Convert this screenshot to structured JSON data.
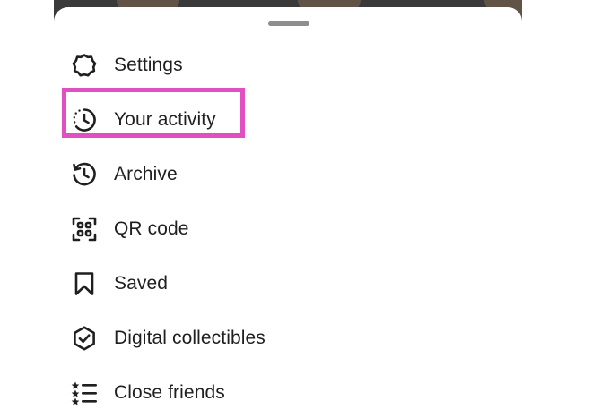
{
  "menu": {
    "items": [
      {
        "id": "settings",
        "label": "Settings",
        "icon": "gear-icon"
      },
      {
        "id": "your-activity",
        "label": "Your activity",
        "icon": "activity-clock-icon"
      },
      {
        "id": "archive",
        "label": "Archive",
        "icon": "archive-history-icon"
      },
      {
        "id": "qr-code",
        "label": "QR code",
        "icon": "qr-code-icon"
      },
      {
        "id": "saved",
        "label": "Saved",
        "icon": "bookmark-icon"
      },
      {
        "id": "digital-collectibles",
        "label": "Digital collectibles",
        "icon": "verified-shield-icon"
      },
      {
        "id": "close-friends",
        "label": "Close friends",
        "icon": "star-list-icon"
      }
    ]
  },
  "highlight": {
    "target": "your-activity",
    "color": "#e14fc0"
  },
  "colors": {
    "text": "#1f1f1f",
    "sheet": "#ffffff",
    "handle": "#8e8e8e"
  }
}
